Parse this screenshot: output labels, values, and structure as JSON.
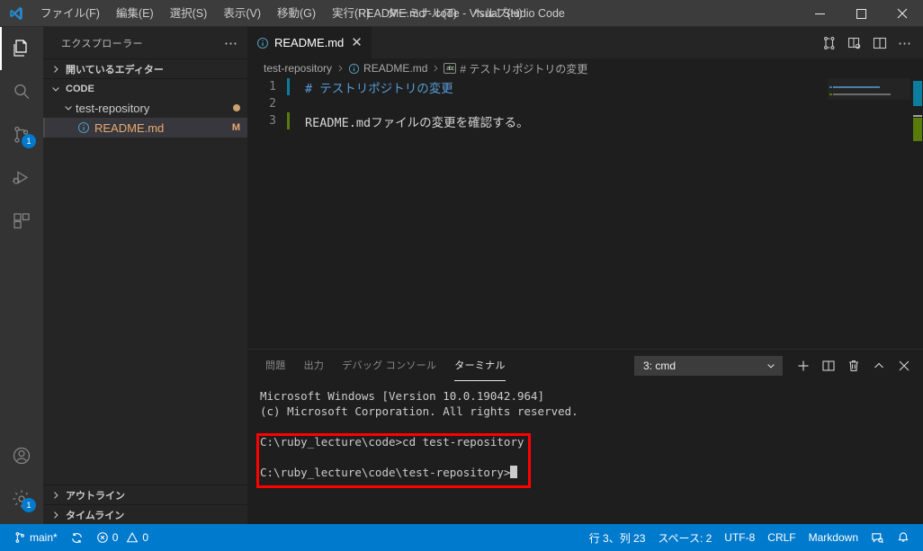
{
  "titlebar": {
    "logo_icon": "vscode-logo-icon",
    "menus": [
      {
        "label": "ファイル(F)",
        "name": "menu-file"
      },
      {
        "label": "編集(E)",
        "name": "menu-edit"
      },
      {
        "label": "選択(S)",
        "name": "menu-selection"
      },
      {
        "label": "表示(V)",
        "name": "menu-view"
      },
      {
        "label": "移動(G)",
        "name": "menu-go"
      },
      {
        "label": "実行(R)",
        "name": "menu-run"
      },
      {
        "label": "ターミナル(T)",
        "name": "menu-terminal"
      },
      {
        "label": "ヘルプ(H)",
        "name": "menu-help"
      }
    ],
    "window_title": "README.md - code - Visual Studio Code",
    "minimize": "—",
    "maximize": "□",
    "close": "✕"
  },
  "activitybar": {
    "items": [
      {
        "name": "activity-explorer",
        "icon": "files-icon",
        "active": true,
        "badge": null
      },
      {
        "name": "activity-search",
        "icon": "search-icon",
        "active": false,
        "badge": null
      },
      {
        "name": "activity-source-control",
        "icon": "source-control-icon",
        "active": false,
        "badge": "1"
      },
      {
        "name": "activity-run-debug",
        "icon": "run-and-debug-icon",
        "active": false,
        "badge": null
      },
      {
        "name": "activity-extensions",
        "icon": "extensions-icon",
        "active": false,
        "badge": null
      }
    ],
    "bottom": [
      {
        "name": "activity-accounts",
        "icon": "account-icon",
        "badge": null
      },
      {
        "name": "activity-settings",
        "icon": "gear-icon",
        "badge": "1"
      }
    ]
  },
  "sidebar": {
    "title": "エクスプローラー",
    "more_actions": "⋯",
    "open_editors_label": "開いているエディター",
    "folder_label": "CODE",
    "tree": [
      {
        "name": "tree-item-test-repository",
        "label": "test-repository",
        "indent": 20,
        "expanded": true,
        "badge": "",
        "dot": true,
        "selected": false,
        "icon": null
      },
      {
        "name": "tree-item-readme",
        "label": "README.md",
        "indent": 38,
        "expanded": null,
        "badge": "M",
        "dot": false,
        "selected": true,
        "icon": "markdown-file-icon"
      }
    ],
    "outline_label": "アウトライン",
    "timeline_label": "タイムライン"
  },
  "editor": {
    "tab": {
      "label": "README.md",
      "icon": "markdown-file-icon",
      "close": "✕"
    },
    "actions": [
      {
        "name": "open-changes-icon",
        "title": "open-changes"
      },
      {
        "name": "open-preview-to-side-icon",
        "title": "preview"
      },
      {
        "name": "split-editor-icon",
        "title": "split"
      },
      {
        "name": "more-actions-icon",
        "title": "⋯"
      }
    ],
    "breadcrumb": [
      {
        "label": "test-repository",
        "icon": null
      },
      {
        "label": "README.md",
        "icon": "markdown-file-icon"
      },
      {
        "label": "# テストリポジトリの変更",
        "icon": "symbol-string-icon"
      }
    ],
    "lines": [
      {
        "num": "1",
        "text": "# テストリポジトリの変更",
        "kind": "heading",
        "gutter": "modified"
      },
      {
        "num": "2",
        "text": "",
        "kind": "plain",
        "gutter": "none"
      },
      {
        "num": "3",
        "text": "README.mdファイルの変更を確認する。",
        "kind": "plain",
        "gutter": "added"
      }
    ]
  },
  "panel": {
    "tabs": [
      {
        "label": "問題",
        "name": "panel-tab-problems",
        "active": false
      },
      {
        "label": "出力",
        "name": "panel-tab-output",
        "active": false
      },
      {
        "label": "デバッグ コンソール",
        "name": "panel-tab-debug-console",
        "active": false
      },
      {
        "label": "ターミナル",
        "name": "panel-tab-terminal",
        "active": true
      }
    ],
    "terminal_select": {
      "value": "3: cmd",
      "chevron": "∨"
    },
    "actions": [
      {
        "name": "new-terminal-icon",
        "glyph": "+"
      },
      {
        "name": "split-terminal-icon",
        "glyph": "split"
      },
      {
        "name": "kill-terminal-icon",
        "glyph": "trash"
      },
      {
        "name": "maximize-panel-icon",
        "glyph": "^"
      },
      {
        "name": "close-panel-icon",
        "glyph": "✕"
      }
    ],
    "terminal_lines": [
      "Microsoft Windows [Version 10.0.19042.964]",
      "(c) Microsoft Corporation. All rights reserved.",
      "",
      "C:\\ruby_lecture\\code>cd test-repository",
      "",
      "C:\\ruby_lecture\\code\\test-repository>"
    ]
  },
  "statusbar": {
    "branch": "main*",
    "sync_icon": "sync-icon",
    "errors": "0",
    "warnings": "0",
    "position": "行 3、列 23",
    "indent": "スペース: 2",
    "encoding": "UTF-8",
    "eol": "CRLF",
    "language": "Markdown",
    "feedback_icon": "feedback-icon",
    "bell_icon": "bell-icon"
  },
  "colors": {
    "accent": "#007acc",
    "titlebar_bg": "#3c3c3c",
    "activitybar_bg": "#333333",
    "sidebar_bg": "#252526",
    "editor_bg": "#1e1e1e",
    "annotation_red": "#ff0000",
    "heading_blue": "#569cd6",
    "modified_orange": "#c9a26d",
    "git_added": "#587c0c",
    "git_modified": "#0c7d9d"
  }
}
